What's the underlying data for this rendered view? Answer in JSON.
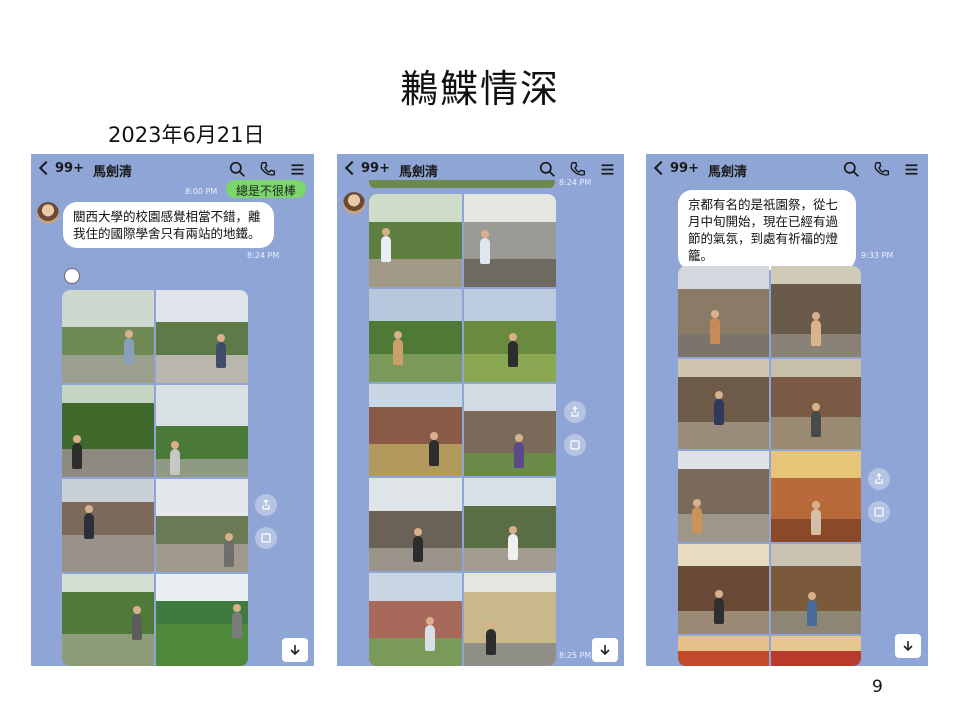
{
  "slide": {
    "title": "鶼鰈情深",
    "date": "2023年6月21日",
    "page_number": "9"
  },
  "phones": [
    {
      "header": {
        "unread": "99+",
        "contact": "馬劍清",
        "icons": [
          "search-icon",
          "phone-icon",
          "menu-icon"
        ]
      },
      "sent_preview": "總是不很棒",
      "sent_time": "8:00 PM",
      "message": "關西大學的校園感覺相當不錯，離我住的國際學舍只有兩站的地鐵。",
      "message_time": "8:24 PM"
    },
    {
      "header": {
        "unread": "99+",
        "contact": "馬劍清",
        "icons": [
          "search-icon",
          "phone-icon",
          "menu-icon"
        ]
      },
      "top_time": "8:24 PM",
      "bottom_time": "8:25 PM"
    },
    {
      "header": {
        "unread": "99+",
        "contact": "馬劍清",
        "icons": [
          "search-icon",
          "phone-icon",
          "menu-icon"
        ]
      },
      "message": "京都有名的是祇園祭，從七月中旬開始，現在已經有過節的氣氛，到處有祈福的燈籠。",
      "message_time": "9:33 PM"
    }
  ],
  "colors": {
    "chat_background": "#8fa5d5",
    "bubble": "#ffffff",
    "sent_bubble": "#7cd66b"
  },
  "icons": {
    "share": "share-icon",
    "screen": "screen-icon",
    "scroll_down": "arrow-down-icon"
  }
}
